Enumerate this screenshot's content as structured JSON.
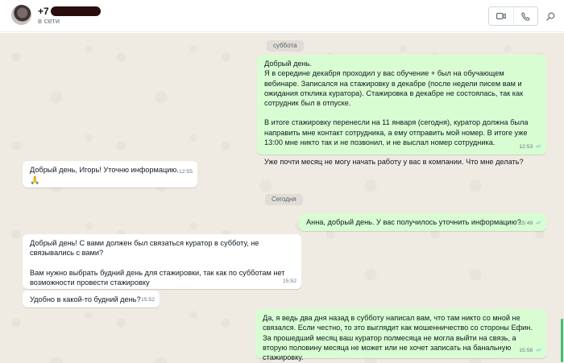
{
  "header": {
    "contact_prefix": "+7",
    "status": "в сети"
  },
  "icons": {
    "video": "video-camera-icon",
    "call": "phone-icon",
    "search": "search-icon",
    "ticks": "double-check-icon"
  },
  "colors": {
    "outgoing_bubble": "#d9fdd3",
    "incoming_bubble": "#ffffff",
    "chat_background": "#efeae2",
    "read_ticks": "#53bdeb",
    "scroll_thumb": "#3fbf6f"
  },
  "dates": {
    "saturday": "суббота",
    "today": "Сегодня"
  },
  "messages": {
    "m1": {
      "p1": "Добрый день.\nЯ в середине декабря проходил у вас обучение + был на обучающем вебинаре. Записался на стажировку в декабре (после недели писем вам и ожидания отклика куратора). Стажировка в декабре не состоялась, так как сотрудник был в отпуске.",
      "p2": "В итоге стажировку перенесли на 11 января (сегодня), куратор должна была направить мне контакт сотрудника, а ему отправить мой номер. В итоге уже 13:00 мне никто так и не позвонил, и не выслал номер сотрудника.",
      "p3": "Уже почти месяц не могу начать работу у вас в компании. Что мне делать?",
      "time": "12:53",
      "ticks": "✓✓"
    },
    "m2": {
      "text": "Добрый день, Игорь! Уточню информацию.",
      "emoji": "🙏",
      "time": "12:55"
    },
    "m3": {
      "text": "Анна, добрый день. У вас получилось уточнить информацию?",
      "time": "15:49",
      "ticks": "✓✓"
    },
    "m4": {
      "p1": "Добрый день! С вами должен был связаться куратор в субботу, не связывались с вами?",
      "p2": "Вам нужно выбрать будний день для стажировки, так как по субботам нет возможности провести стажировку",
      "time": "15:52"
    },
    "m5": {
      "text": "Удобно в какой-то будний день?",
      "time": "15:52"
    },
    "m6": {
      "text": "Да, я ведь два дня назад в субботу написал вам, что там никто со мной не связался. Если честно, то это выглядит как мошенничество со стороны Ефин. За прошедший месяц ваш куратор полмесяца не могла выйти на связь, а вторую половину месяца не может или не хочет записать на банальную стажировку.",
      "time": "15:58",
      "ticks": "✓✓"
    }
  }
}
